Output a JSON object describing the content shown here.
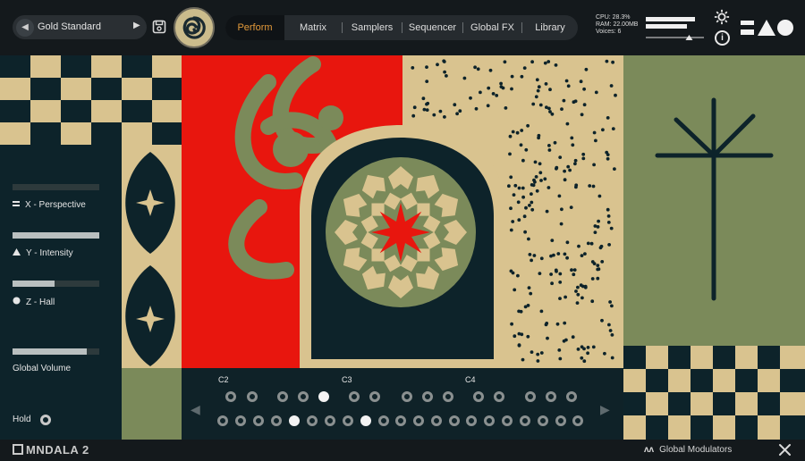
{
  "topbar": {
    "preset_name": "Gold Standard",
    "tabs": [
      "Perform",
      "Matrix",
      "Samplers",
      "Sequencer",
      "Global FX",
      "Library"
    ],
    "active_tab": "Perform",
    "stats": {
      "cpu": "CPU: 28.3%",
      "ram": "RAM: 22.00MB",
      "voices": "Voices: 6"
    },
    "meter_levels": [
      0.85,
      0.7
    ],
    "output_level": 0.78
  },
  "controls": {
    "x": {
      "label": "X - Perspective",
      "value": 0.0,
      "icon": "double-bar-icon"
    },
    "y": {
      "label": "Y - Intensity",
      "value": 1.0,
      "icon": "triangle-icon"
    },
    "z": {
      "label": "Z - Hall",
      "value": 0.48,
      "icon": "circle-icon"
    },
    "global_volume": {
      "label": "Global Volume",
      "value": 0.86
    },
    "hold": {
      "label": "Hold"
    }
  },
  "keyboard": {
    "octave_labels": [
      "C2",
      "C3",
      "C4"
    ],
    "black_keys_active": [
      4
    ],
    "white_keys_active": [
      4,
      8
    ]
  },
  "bottombar": {
    "brand": "MNDALA 2",
    "global_modulators": "Global Modulators"
  },
  "colors": {
    "red": "#e8160e",
    "sage": "#7b8a5a",
    "navy": "#0d232a",
    "beige": "#d9c38f",
    "accent": "#e39a3a"
  }
}
